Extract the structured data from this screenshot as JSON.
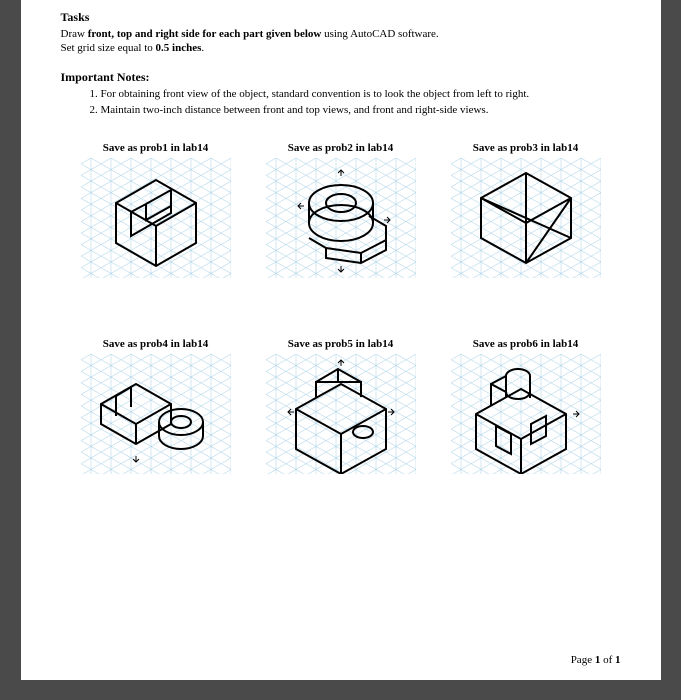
{
  "tasksHeading": "Tasks",
  "tasksLine1_pre": "Draw ",
  "tasksLine1_bold": "front, top and right side for each part given below",
  "tasksLine1_post": " using AutoCAD software.",
  "tasksLine2_pre": "Set grid size equal to ",
  "tasksLine2_bold": "0.5 inches",
  "tasksLine2_post": ".",
  "notesHeading": "Important Notes:",
  "note1_pre": "For obtaining ",
  "note1_b1": "front view",
  "note1_mid": " of the object, standard convention is to look the object from ",
  "note1_b2": "left to right",
  "note1_post": ".",
  "note2": "Maintain two-inch distance between front and top views, and front and right-side views.",
  "captions": {
    "c1": "Save as prob1 in lab14",
    "c2": "Save as prob2 in lab14",
    "c3": "Save as prob3 in lab14",
    "c4": "Save as prob4 in lab14",
    "c5": "Save as prob5 in lab14",
    "c6": "Save as prob6 in lab14"
  },
  "footer_pre": "Page ",
  "footer_b1": "1",
  "footer_mid": " of ",
  "footer_b2": "1"
}
